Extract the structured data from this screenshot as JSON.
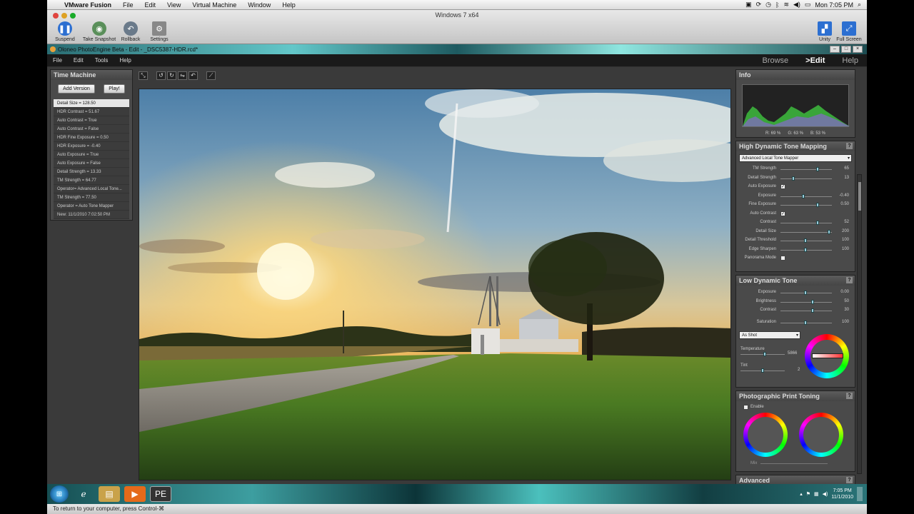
{
  "mac_menubar": {
    "items": [
      "VMware Fusion",
      "File",
      "Edit",
      "View",
      "Virtual Machine",
      "Window",
      "Help"
    ],
    "clock": "Mon 7:05 PM"
  },
  "vmware": {
    "window_title": "Windows 7 x64",
    "buttons": [
      "Suspend",
      "Take Snapshot",
      "Rollback",
      "Settings"
    ],
    "right_buttons": [
      "Unity",
      "Full Screen"
    ]
  },
  "app": {
    "title": "Oloneo PhotoEngine Beta - Edit - _DSC5387-HDR.rcd*",
    "menu": [
      "File",
      "Edit",
      "Tools",
      "Help"
    ],
    "modes": [
      "Browse",
      ">Edit",
      "Help"
    ],
    "active_mode": ">Edit"
  },
  "time_machine": {
    "title": "Time Machine",
    "add_version": "Add Version",
    "play": "Play!",
    "entries": [
      "Detail Size = 128.50",
      "HDR Contrast = 51.67",
      "Auto Contrast = True",
      "Auto Contrast = False",
      "HDR Fine Exposure = 0.50",
      "HDR Exposure = -0.40",
      "Auto Exposure = True",
      "Auto Exposure = False",
      "Detail Strength = 13.33",
      "TM Strength = 64.77",
      "Operator= Advanced Local Tone...",
      "TM Strength = 77.50",
      "Operator = Auto Tone Mapper",
      "New: 11/1/2010 7:02:50 PM"
    ]
  },
  "info": {
    "title": "Info",
    "r": "R: 69 %",
    "g": "G: 63 %",
    "b": "B: 53 %"
  },
  "hdr_tone_mapping": {
    "title": "High Dynamic Tone Mapping",
    "operator": "Advanced Local Tone Mapper",
    "sliders_top": [
      {
        "label": "TM Strength",
        "value": "65",
        "pos": 0.72
      },
      {
        "label": "Detail Strength",
        "value": "13",
        "pos": 0.25
      }
    ],
    "auto_exposure": {
      "label": "Auto Exposure",
      "checked": "✓"
    },
    "sliders_exposure": [
      {
        "label": "Exposure",
        "value": "-0.40",
        "pos": 0.45
      },
      {
        "label": "Fine Exposure",
        "value": "0.50",
        "pos": 0.72
      }
    ],
    "auto_contrast": {
      "label": "Auto Contrast",
      "checked": "✓"
    },
    "sliders_contrast": [
      {
        "label": "Contrast",
        "value": "52",
        "pos": 0.72
      }
    ],
    "sliders_detail": [
      {
        "label": "Detail Size",
        "value": "200",
        "pos": 0.95
      },
      {
        "label": "Detail Threshold",
        "value": "100",
        "pos": 0.48
      },
      {
        "label": "Edge Sharpen",
        "value": "100",
        "pos": 0.48
      }
    ],
    "panorama_mode": {
      "label": "Panorama Mode",
      "checked": ""
    }
  },
  "low_dynamic_tone": {
    "title": "Low Dynamic Tone",
    "sliders": [
      {
        "label": "Exposure",
        "value": "0.00",
        "pos": 0.48
      },
      {
        "label": "Brightness",
        "value": "50",
        "pos": 0.62
      },
      {
        "label": "Contrast",
        "value": "30",
        "pos": 0.62
      }
    ],
    "saturation": {
      "label": "Saturation",
      "value": "100",
      "pos": 0.48
    },
    "white_balance": "As Shot",
    "temperature": {
      "label": "Temperature",
      "value": "5866",
      "pos": 0.55
    },
    "tint": {
      "label": "Tint",
      "value": "2",
      "pos": 0.5
    }
  },
  "print_toning": {
    "title": "Photographic Print Toning",
    "enable": "Enable",
    "mix": "Mix"
  },
  "advanced": {
    "title": "Advanced"
  },
  "taskbar": {
    "time": "7:05 PM",
    "date": "11/1/2010"
  },
  "status": "To return to your computer, press Control-⌘"
}
